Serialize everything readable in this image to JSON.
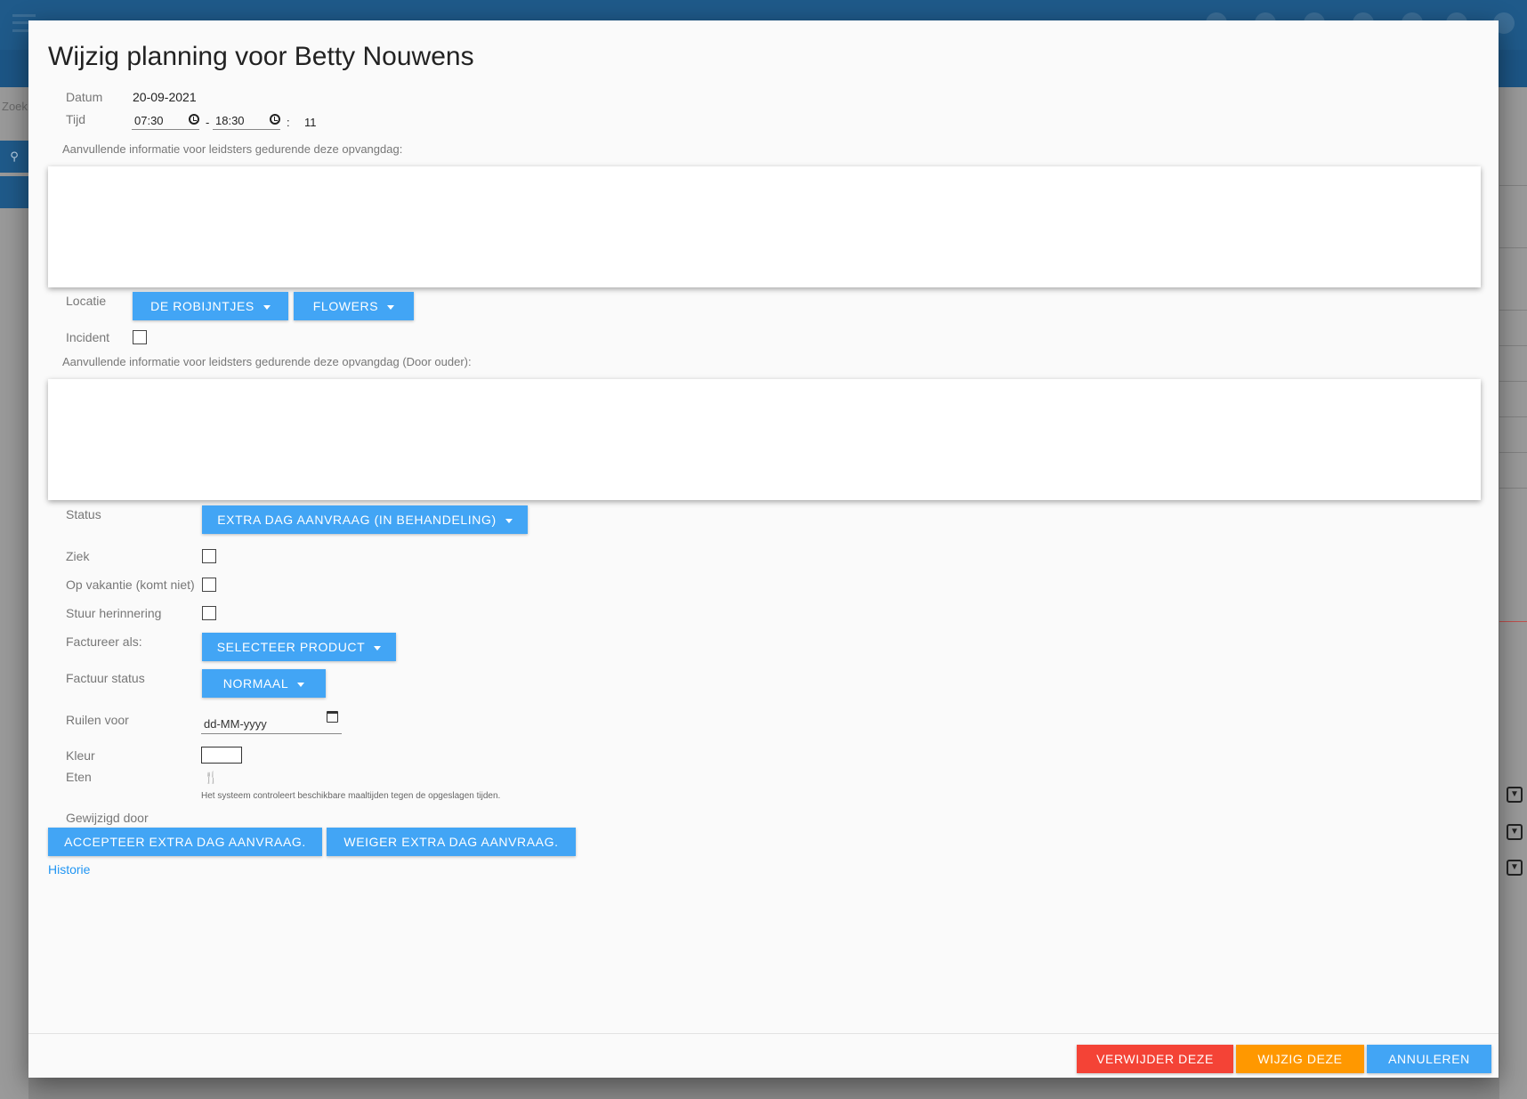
{
  "background": {
    "search_label": "Zoek"
  },
  "dialog": {
    "title": "Wijzig planning voor Betty Nouwens",
    "datum": {
      "label": "Datum",
      "value": "20-09-2021"
    },
    "tijd": {
      "label": "Tijd",
      "start": "07:30",
      "separator": "-",
      "end": "18:30",
      "colon": ":",
      "hours": "11"
    },
    "info_label": "Aanvullende informatie voor leidsters gedurende deze opvangdag:",
    "locatie": {
      "label": "Locatie",
      "location_button": "DE ROBIJNTJES",
      "group_button": "FLOWERS"
    },
    "incident": {
      "label": "Incident"
    },
    "parent_info_label": "Aanvullende informatie voor leidsters gedurende deze opvangdag (Door ouder):",
    "status": {
      "label": "Status",
      "button": "EXTRA DAG AANVRAAG (IN BEHANDELING)"
    },
    "ziek": {
      "label": "Ziek"
    },
    "vakantie": {
      "label": "Op vakantie (komt niet)"
    },
    "herinnering": {
      "label": "Stuur herinnering"
    },
    "factureer": {
      "label": "Factureer als:",
      "button": "SELECTEER PRODUCT"
    },
    "factuur_status": {
      "label": "Factuur status",
      "button": "NORMAAL"
    },
    "ruilen": {
      "label": "Ruilen voor",
      "placeholder": "dd-MM-yyyy"
    },
    "kleur": {
      "label": "Kleur"
    },
    "eten": {
      "label": "Eten",
      "hint": "Het systeem controleert beschikbare maaltijden tegen de opgeslagen tijden."
    },
    "gewijzigd_door": {
      "label": "Gewijzigd door"
    },
    "accept_button": "ACCEPTEER EXTRA DAG AANVRAAG.",
    "reject_button": "WEIGER EXTRA DAG AANVRAAG.",
    "historie_link": "Historie",
    "footer": {
      "delete_button": "VERWIJDER DEZE",
      "edit_button": "WIJZIG DEZE",
      "cancel_button": "ANNULEREN"
    }
  },
  "colors": {
    "primary": "#42a5f5",
    "danger": "#f44336",
    "warning": "#ff9800",
    "header": "#1f5a8a"
  },
  "icons": [
    "menu-icon",
    "clock-icon",
    "caret-down-icon",
    "calendar-icon",
    "food-icon",
    "search-icon"
  ]
}
